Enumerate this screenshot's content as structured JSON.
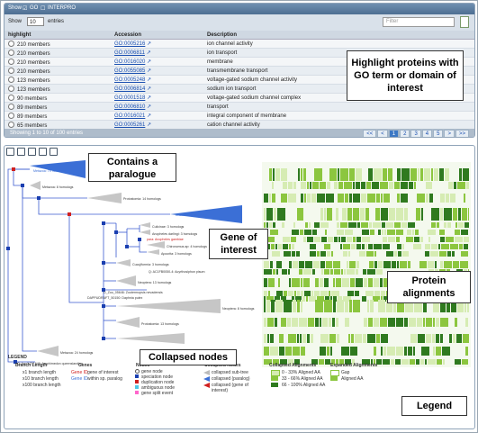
{
  "controls": {
    "show": "Show",
    "go": "GO",
    "interpro": "INTERPRO",
    "show2": "Show",
    "page_size": "10",
    "entries": "entries",
    "filter_placeholder": "Filter"
  },
  "table": {
    "headers": [
      "highlight",
      "Accession",
      "Description"
    ],
    "rows": [
      {
        "highlight": "210 members",
        "accession": "GO:0005216",
        "description": "ion channel activity"
      },
      {
        "highlight": "210 members",
        "accession": "GO:0006811",
        "description": "ion transport"
      },
      {
        "highlight": "210 members",
        "accession": "GO:0016020",
        "description": "membrane"
      },
      {
        "highlight": "210 members",
        "accession": "GO:0055085",
        "description": "transmembrane transport"
      },
      {
        "highlight": "123 members",
        "accession": "GO:0005248",
        "description": "voltage-gated sodium channel activity"
      },
      {
        "highlight": "123 members",
        "accession": "GO:0006814",
        "description": "sodium ion transport"
      },
      {
        "highlight": "90 members",
        "accession": "GO:0001518",
        "description": "voltage-gated sodium channel complex"
      },
      {
        "highlight": "89 members",
        "accession": "GO:0006810",
        "description": "transport"
      },
      {
        "highlight": "89 members",
        "accession": "GO:0016021",
        "description": "integral component of membrane"
      },
      {
        "highlight": "65 members",
        "accession": "GO:0005261",
        "description": "cation channel activity"
      }
    ],
    "footer": "Showing 1 to 10 of 100 entries",
    "pager": [
      "<<",
      "<",
      "1",
      "2",
      "3",
      "4",
      "5",
      ">",
      ">>"
    ]
  },
  "tree": {
    "labels": [
      "Metazoa: 79 homologs",
      "Metazoa: 8 homologs",
      "Protostomia: 14 homologs",
      "Bilateria: 41 homologs",
      "Culicinae: 3 homologs",
      "Anopheles darlingi: 3 homologs",
      "para: Anopheles gambiae",
      "Chironomus ap: 4 homologs",
      "Apocrita: 3 homologs",
      "Cucujiformia: 3 homologs",
      "Q: AC1FB0050-4: Acyrthosiphon pisum",
      "Neoptera: 13 homologs",
      "D_Zoo_05646: Zootermopsis nevadensis",
      "DAPPUDRAFT_50150: Daphnia pulex",
      "Neoptera: 8 homologs",
      "Protostomia: 13 homologs",
      "Metazoa: 24 homologs",
      "Q: Aqu1.211646: Amphimedon queenslandica"
    ]
  },
  "legend": {
    "title": "LEGEND",
    "branch_title": "Branch Length",
    "branch": [
      "x1 branch length",
      "x10 branch length",
      "x100 branch length"
    ],
    "genes_title": "Genes",
    "genes": [
      "Gene ID",
      "gene of interest",
      "Gene ID",
      "within sp. paralog"
    ],
    "nodes_title": "Nodes",
    "nodes": [
      "gene node",
      "speciation node",
      "duplication node",
      "ambiguous node",
      "gene split event"
    ],
    "collapsed_title": "Collapsed Nodes",
    "collapsed": [
      "collapsed sub-tree",
      "collapsed (paralog)",
      "collapsed (gene of interest)"
    ],
    "calign_title": "Collapsed Alignments",
    "calign": [
      "0 - 33% Aligned AA",
      "33 - 66% Aligned AA",
      "66 - 100% Aligned AA"
    ],
    "ealign_title": "Expanded Alignments",
    "ealign": [
      "Gap",
      "Aligned AA"
    ]
  },
  "callouts": {
    "highlight": "Highlight proteins with GO term or domain of interest",
    "paralogue": "Contains a paralogue",
    "gene": "Gene of interest",
    "protein": "Protein alignments",
    "collapsed": "Collapsed nodes",
    "legend": "Legend"
  },
  "colors": {
    "header": "#4d6e92",
    "accent": "#3d78c4",
    "interest": "#e02020",
    "align_dark": "#2f7a1f",
    "align_mid": "#8cc63f",
    "align_light": "#d6ecb3"
  }
}
